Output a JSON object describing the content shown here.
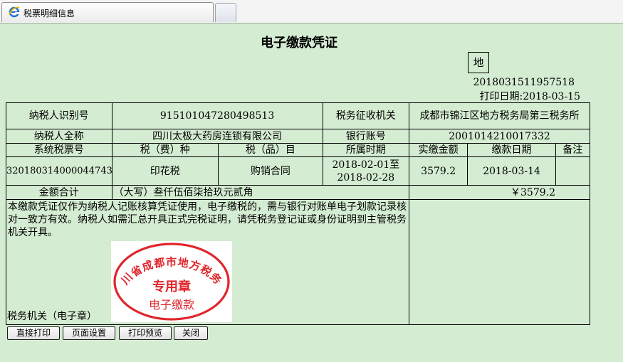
{
  "tab": {
    "title": "税票明细信息",
    "icon": "ie-icon"
  },
  "document": {
    "title": "电子缴款凭证",
    "copy_mark": "地",
    "serial_no": "2018031511957518",
    "print_date": "打印日期:2018-03-15"
  },
  "table": {
    "row1": {
      "taxpayer_id_label": "纳税人识别号",
      "taxpayer_id": "915101047280498513",
      "collector_label": "税务征收机关",
      "collector": "成都市锦江区地方税务局第三税务所"
    },
    "row2": {
      "taxpayer_name_label": "纳税人全称",
      "taxpayer_name": "四川太极大药房连锁有限公司",
      "bank_account_label": "银行账号",
      "bank_account": "2001014210017332"
    },
    "headers": [
      "系统税票号",
      "税（费）种",
      "税（品）目",
      "所属时期",
      "实缴金额",
      "缴款日期",
      "备注"
    ],
    "item": {
      "ticket_no": "320180314000044743",
      "tax_type": "印花税",
      "tax_item": "购销合同",
      "period": "2018-02-01至2018-02-28",
      "amount": "3579.2",
      "pay_date": "2018-03-14",
      "remark": ""
    },
    "total": {
      "label": "金额合计",
      "uppercase": "（大写）叁仟伍佰柒拾玖元贰角",
      "amount": "￥3579.2"
    },
    "notice": "本缴款凭证仅作为纳税人记账核算凭证使用，电子缴税的，需与银行对账单电子划款记录核对一致方有效。纳税人如需汇总开具正式完税证明，请凭税务登记证或身份证明到主管税务机关开具。",
    "tax_office_label": "税务机关（电子章）",
    "seal": {
      "arc_text": "四川省成都市地方税务局",
      "center_text": "专用章",
      "bottom_text": "电子缴款",
      "color": "#e0262c"
    }
  },
  "buttons": {
    "direct_print": "直接打印",
    "page_setup": "页面设置",
    "print_preview": "打印预览",
    "close": "关闭"
  }
}
